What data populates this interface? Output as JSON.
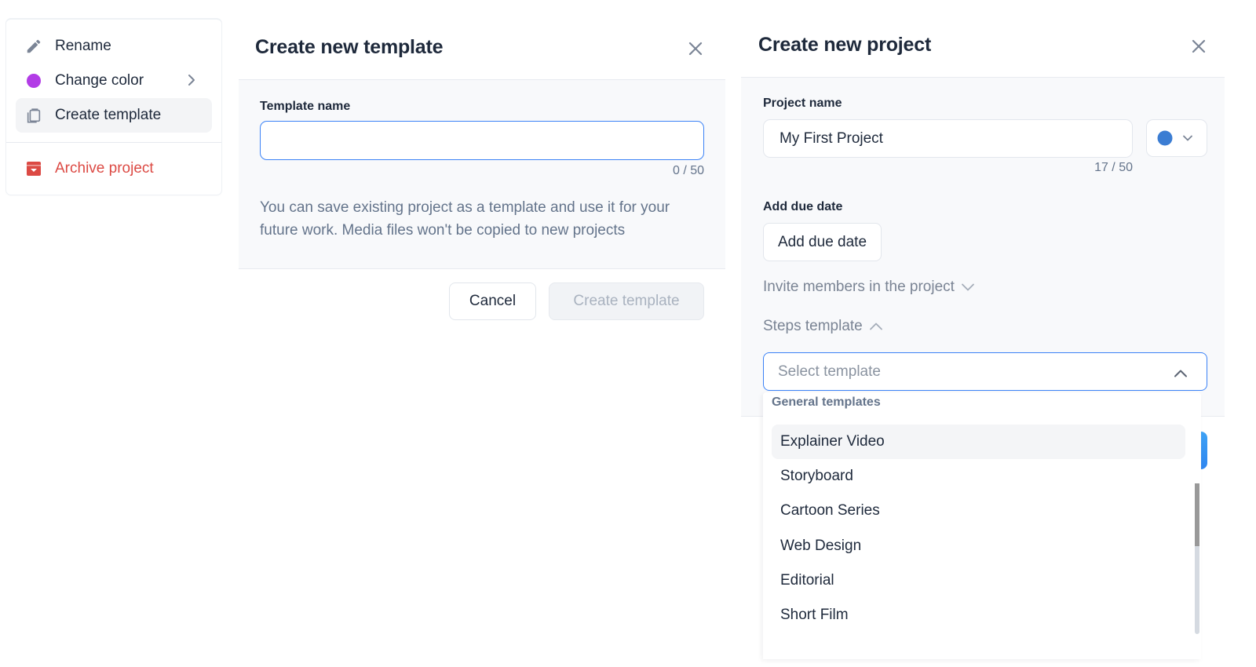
{
  "context_menu": {
    "items": [
      {
        "label": "Rename",
        "icon": "pencil-icon"
      },
      {
        "label": "Change color",
        "icon": "color-dot-icon",
        "color": "#b23ce6",
        "has_submenu": true
      },
      {
        "label": "Create template",
        "icon": "clipboard-copy-icon",
        "active": true
      },
      {
        "label": "Archive project",
        "icon": "archive-icon",
        "color": "#dc4a44",
        "danger": true
      }
    ]
  },
  "template_dialog": {
    "title": "Create new template",
    "field_label": "Template name",
    "input_value": "",
    "counter": "0 / 50",
    "hint": "You can save existing project as a template and use it for your future work. Media files won't be copied to new projects",
    "cancel_label": "Cancel",
    "submit_label": "Create template"
  },
  "project_dialog": {
    "title": "Create new project",
    "name_label": "Project name",
    "name_value": "My First Project",
    "name_counter": "17 / 50",
    "selected_color": "#3b7dd3",
    "due_date_label": "Add due date",
    "due_date_button": "Add due date",
    "invite_toggle": "Invite members in the project",
    "steps_toggle": "Steps template",
    "select_placeholder": "Select template",
    "dropdown": {
      "group_label": "General templates",
      "options": [
        "Explainer Video",
        "Storyboard",
        "Cartoon Series",
        "Web Design",
        "Editorial",
        "Short Film"
      ],
      "highlighted": "Explainer Video"
    }
  },
  "colors": {
    "accent": "#3b82f6",
    "danger": "#dc4a44",
    "text": "#1e293b",
    "muted": "#64748b"
  }
}
